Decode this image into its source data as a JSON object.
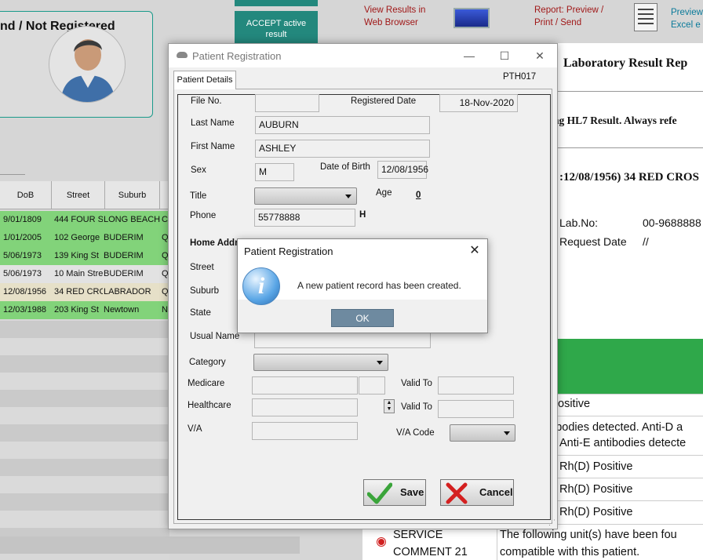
{
  "patient_card": {
    "title": "nd / Not Registered"
  },
  "accept_button": {
    "line1": "ACCEPT active",
    "line2": "result"
  },
  "toolbar": {
    "view_results_line1": "View Results in",
    "view_results_line2": "Web Browser",
    "report_line1": "Report:  Preview /",
    "report_line2": "Print / Send",
    "preview_line1": "Preview",
    "preview_line2": "Excel e"
  },
  "grid": {
    "headers": [
      "DoB",
      "Street",
      "Suburb",
      ""
    ],
    "rows": [
      {
        "dob": "9/01/1809",
        "street": "444 FOUR S",
        "suburb": "LONG BEACH",
        "extra": "C"
      },
      {
        "dob": "1/01/2005",
        "street": "102 George",
        "suburb": "BUDERIM",
        "extra": "Q"
      },
      {
        "dob": "5/06/1973",
        "street": "139 King St",
        "suburb": "BUDERIM",
        "extra": "Q"
      },
      {
        "dob": "5/06/1973",
        "street": "10 Main Stre",
        "suburb": "BUDERIM",
        "extra": "Q"
      },
      {
        "dob": "12/08/1956",
        "street": "34 RED CRC",
        "suburb": "LABRADOR",
        "extra": "Q"
      },
      {
        "dob": "12/03/1988",
        "street": "203 King St",
        "suburb": "Newtown",
        "extra": "N"
      }
    ]
  },
  "report": {
    "title": "Laboratory Result Rep",
    "hl7": "ng HL7 Result. Always refe",
    "dob_line": ":12/08/1956) 34 RED CROS",
    "lab_no_label": "Lab.No:",
    "lab_no_value": "00-9688888",
    "request_date_label": "Request Date",
    "request_date_value": "//",
    "results": [
      "ositive",
      "ibodies detected. Anti-D a",
      "Anti-E antibodies detecte",
      "Rh(D) Positive",
      "Rh(D) Positive",
      "Rh(D) Positive"
    ],
    "service_label_1": "SERVICE",
    "service_label_2": "COMMENT 21",
    "service_text_1": "The following unit(s) have been fou",
    "service_text_2": "compatible with this patient."
  },
  "registration": {
    "window_title": "Patient Registration",
    "tab_label": "Patient Details",
    "code": "PTH017",
    "labels": {
      "file_no": "File No.",
      "registered_date": "Registered Date",
      "last_name": "Last Name",
      "first_name": "First Name",
      "sex": "Sex",
      "date_of_birth": "Date of Birth",
      "title": "Title",
      "age": "Age",
      "phone": "Phone",
      "home_address": "Home Addr",
      "street": "Street",
      "suburb": "Suburb",
      "state": "State",
      "usual_name": "Usual Name",
      "category": "Category",
      "medicare": "Medicare",
      "valid_to": "Valid To",
      "healthcare": "Healthcare",
      "va": "V/A",
      "va_code": "V/A Code"
    },
    "values": {
      "file_no": "",
      "registered_date": "18-Nov-2020",
      "last_name": "AUBURN",
      "first_name": "ASHLEY",
      "sex": "M",
      "date_of_birth": "12/08/1956",
      "age": "0",
      "phone": "55778888",
      "phone_type": "H"
    },
    "save_label": "Save",
    "cancel_label": "Cancel"
  },
  "message_box": {
    "title": "Patient Registration",
    "text": "A new patient record has been created.",
    "ok_label": "OK",
    "close_glyph": "✕",
    "icon": "info-icon"
  },
  "colors": {
    "accent_teal": "#23887d",
    "row_green": "#82d37a",
    "report_green": "#2fa84a",
    "link_red": "#a01818"
  }
}
